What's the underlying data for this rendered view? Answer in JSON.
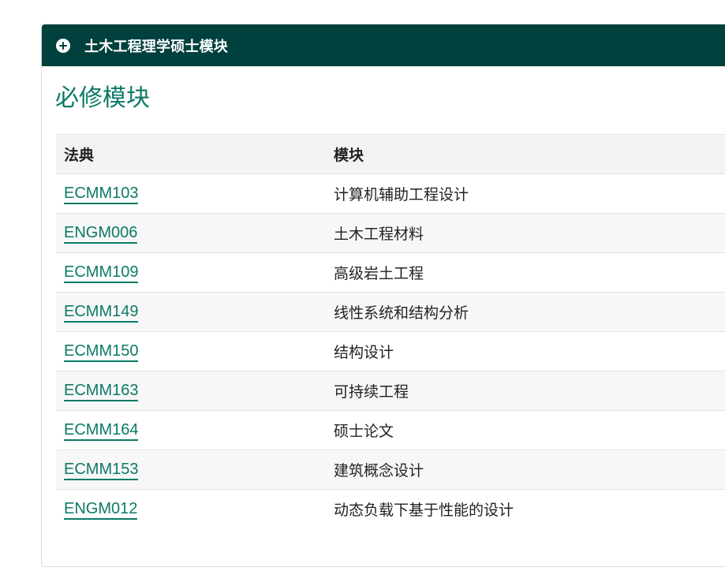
{
  "header": {
    "title": "土木工程理学硕士模块",
    "icon": "plus-circle-icon"
  },
  "section": {
    "title": "必修模块"
  },
  "table": {
    "columns": [
      "法典",
      "模块"
    ],
    "rows": [
      {
        "code": "ECMM103",
        "module": "计算机辅助工程设计"
      },
      {
        "code": "ENGM006",
        "module": "土木工程材料"
      },
      {
        "code": "ECMM109",
        "module": "高级岩土工程"
      },
      {
        "code": "ECMM149",
        "module": "线性系统和结构分析"
      },
      {
        "code": "ECMM150",
        "module": "结构设计"
      },
      {
        "code": "ECMM163",
        "module": "可持续工程"
      },
      {
        "code": "ECMM164",
        "module": "硕士论文"
      },
      {
        "code": "ECMM153",
        "module": "建筑概念设计"
      },
      {
        "code": "ENGM012",
        "module": "动态负载下基于性能的设计"
      }
    ]
  },
  "colors": {
    "header_bg": "#00403d",
    "accent": "#0b7a66"
  }
}
